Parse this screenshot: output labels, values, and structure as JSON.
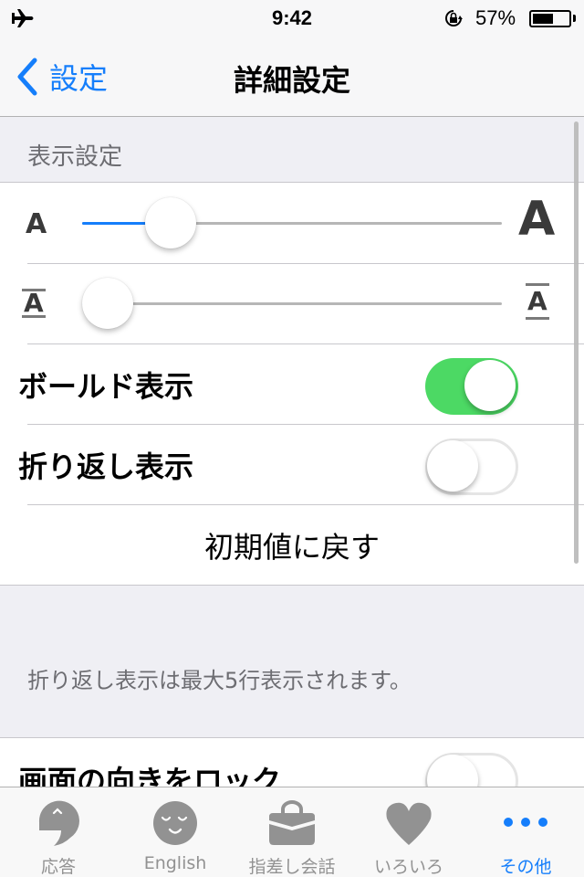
{
  "status_bar": {
    "time": "9:42",
    "battery_text": "57%",
    "battery_level": 0.57,
    "icons": [
      "airplane-icon",
      "rotation-lock-icon",
      "battery-icon"
    ]
  },
  "nav": {
    "back_label": "設定",
    "title": "詳細設定"
  },
  "display_section": {
    "header": "表示設定",
    "font_size_slider": {
      "value": 0.17,
      "min_icon": "A",
      "max_icon": "A"
    },
    "line_spacing_slider": {
      "value": 0.0,
      "min_icon": "A",
      "max_icon": "A"
    },
    "bold": {
      "label": "ボールド表示",
      "on": true
    },
    "wrap": {
      "label": "折り返し表示",
      "on": false
    },
    "reset_label": "初期値に戻す"
  },
  "footer_note": "折り返し表示は最大5行表示されます。",
  "orientation": {
    "label": "画面の向きをロック",
    "on": false
  },
  "colors": {
    "accent": "#157efb",
    "switch_on": "#4cd964",
    "tab_inactive": "#929292"
  },
  "tabs": [
    {
      "label": "応答",
      "icon": "speech-comma-icon",
      "active": false
    },
    {
      "label": "English",
      "icon": "smiley-face-icon",
      "active": false
    },
    {
      "label": "指差し会話",
      "icon": "bag-icon",
      "active": false
    },
    {
      "label": "いろいろ",
      "icon": "heart-icon",
      "active": false
    },
    {
      "label": "その他",
      "icon": "more-dots-icon",
      "active": true
    }
  ]
}
